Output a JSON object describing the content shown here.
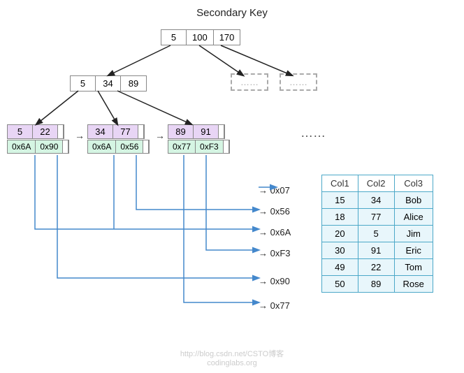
{
  "title": "Secondary Key",
  "root_node": [
    "5",
    "100",
    "170"
  ],
  "level2_node": [
    "5",
    "34",
    "89"
  ],
  "dashed1": "……",
  "dashed2": "……",
  "leaf1": {
    "keys": [
      "5",
      "22"
    ],
    "ptrs": [
      "0x6A",
      "0x90"
    ],
    "next": true
  },
  "leaf2": {
    "keys": [
      "34",
      "77"
    ],
    "ptrs": [
      "0x6A",
      "0x56"
    ],
    "next": true
  },
  "leaf3": {
    "keys": [
      "89",
      "91"
    ],
    "ptrs": [
      "0x77",
      "0xF3"
    ],
    "next": false
  },
  "dots_mid": "……",
  "pointer_rows": [
    {
      "ptr": "0x07",
      "row": {
        "col1": "15",
        "col2": "34",
        "col3": "Bob"
      }
    },
    {
      "ptr": "0x56",
      "row": {
        "col1": "18",
        "col2": "77",
        "col3": "Alice"
      }
    },
    {
      "ptr": "0x6A",
      "row": {
        "col1": "20",
        "col2": "5",
        "col3": "Jim"
      }
    },
    {
      "ptr": "0xF3",
      "row": {
        "col1": "30",
        "col2": "91",
        "col3": "Eric"
      }
    },
    {
      "ptr": "0x90",
      "row": {
        "col1": "49",
        "col2": "22",
        "col3": "Tom"
      }
    },
    {
      "ptr": "0x77",
      "row": {
        "col1": "50",
        "col2": "89",
        "col3": "Rose"
      }
    }
  ],
  "table_headers": [
    "Col1",
    "Col2",
    "Col3"
  ],
  "watermark1": "http://blog.csdn.net/CSTO博客",
  "watermark2": "codinglabs.org"
}
